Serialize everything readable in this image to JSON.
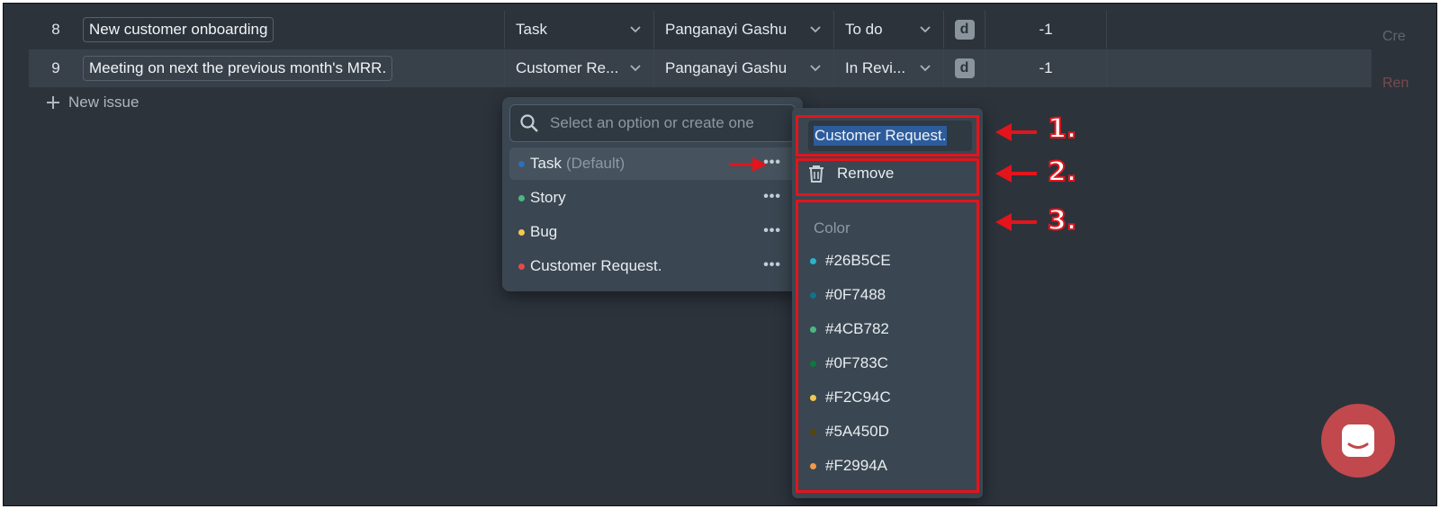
{
  "rows": [
    {
      "num": "8",
      "title": "New customer onboarding",
      "type": "Task",
      "assignee": "Panganayi Gashu",
      "status": "To do",
      "badge": "d",
      "score": "-1"
    },
    {
      "num": "9",
      "title": "Meeting on next the previous month's MRR.",
      "type": "Customer Re...",
      "assignee": "Panganayi Gashu",
      "status": "In Revi...",
      "badge": "d",
      "score": "-1"
    }
  ],
  "new_issue_label": "New issue",
  "right_faint": {
    "top": "Cre",
    "bottom": "Ren"
  },
  "dropdown": {
    "search_placeholder": "Select an option or create one",
    "options": [
      {
        "label": "Task",
        "suffix": "(Default)",
        "color": "#2f6fb5"
      },
      {
        "label": "Story",
        "suffix": "",
        "color": "#4CB782"
      },
      {
        "label": "Bug",
        "suffix": "",
        "color": "#F2C94C"
      },
      {
        "label": "Customer Request.",
        "suffix": "",
        "color": "#e5484d"
      }
    ]
  },
  "panel": {
    "name_value": "Customer Request.",
    "remove_label": "Remove",
    "color_heading": "Color",
    "colors": [
      {
        "label": "#26B5CE",
        "color": "#26B5CE"
      },
      {
        "label": "#0F7488",
        "color": "#0F7488"
      },
      {
        "label": "#4CB782",
        "color": "#4CB782"
      },
      {
        "label": "#0F783C",
        "color": "#0F783C"
      },
      {
        "label": "#F2C94C",
        "color": "#F2C94C"
      },
      {
        "label": "#5A450D",
        "color": "#5A450D"
      },
      {
        "label": "#F2994A",
        "color": "#F2994A"
      }
    ]
  },
  "callouts": [
    "1.",
    "2.",
    "3."
  ]
}
